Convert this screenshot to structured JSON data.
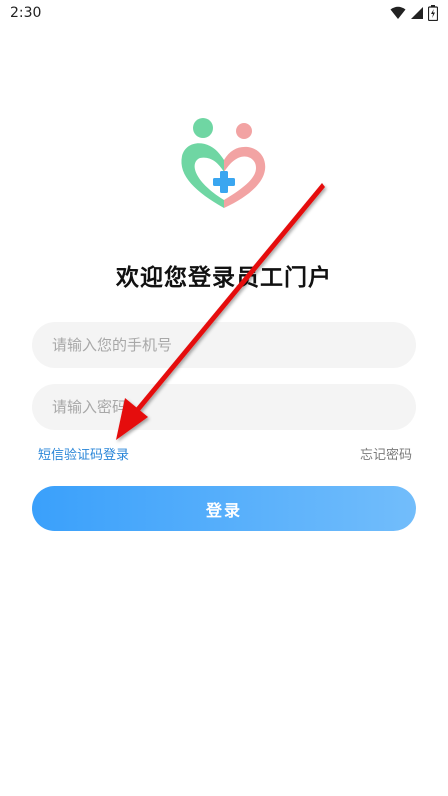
{
  "status_bar": {
    "time": "2:30"
  },
  "title": "欢迎您登录员工门户",
  "form": {
    "phone_placeholder": "请输入您的手机号",
    "password_placeholder": "请输入密码"
  },
  "links": {
    "sms_login": "短信验证码登录",
    "forgot_password": "忘记密码"
  },
  "login_button": "登录",
  "colors": {
    "logo_green": "#6fd6a3",
    "logo_pink": "#f2a3a3",
    "logo_cross": "#3aa6f0",
    "link_blue": "#2a86d8",
    "button_gradient_start": "#3aa0fb",
    "button_gradient_end": "#72bdfb",
    "annotation_arrow": "#e51010"
  },
  "icons": [
    "wifi-icon",
    "signal-icon",
    "battery-icon",
    "heart-care-logo"
  ]
}
